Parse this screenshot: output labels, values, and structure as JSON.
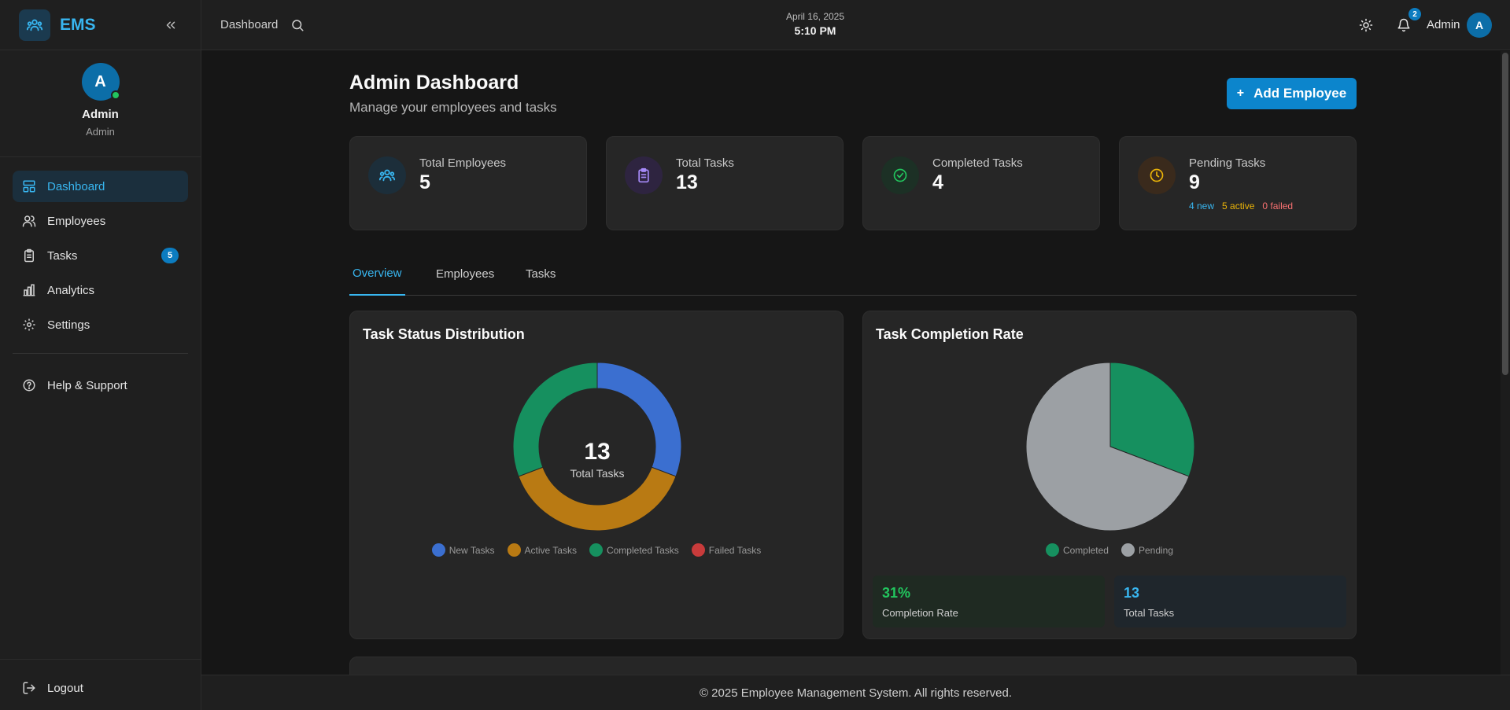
{
  "brand": {
    "name": "EMS",
    "logo_icon": "users-icon"
  },
  "profile": {
    "initial": "A",
    "name": "Admin",
    "role": "Admin"
  },
  "sidebar": {
    "items": [
      {
        "label": "Dashboard",
        "icon": "dashboard-icon",
        "active": true
      },
      {
        "label": "Employees",
        "icon": "users-icon"
      },
      {
        "label": "Tasks",
        "icon": "clipboard-icon",
        "badge": "5"
      },
      {
        "label": "Analytics",
        "icon": "bar-chart-icon"
      },
      {
        "label": "Settings",
        "icon": "gear-icon"
      }
    ],
    "help": {
      "label": "Help & Support",
      "icon": "help-circle-icon"
    },
    "logout": {
      "label": "Logout",
      "icon": "logout-icon"
    }
  },
  "header": {
    "breadcrumb": "Dashboard",
    "date": "April 16, 2025",
    "time": "5:10 PM",
    "notification_count": "2",
    "user_name": "Admin",
    "user_initial": "A"
  },
  "page": {
    "title": "Admin Dashboard",
    "subtitle": "Manage your employees and tasks",
    "add_button": "Add Employee"
  },
  "stats": [
    {
      "label": "Total Employees",
      "value": "5",
      "icon": "users-icon",
      "color": "#38b6f0"
    },
    {
      "label": "Total Tasks",
      "value": "13",
      "icon": "clipboard-icon",
      "color": "#a78bfa"
    },
    {
      "label": "Completed Tasks",
      "value": "4",
      "icon": "check-circle-icon",
      "color": "#22c55e"
    },
    {
      "label": "Pending Tasks",
      "value": "9",
      "icon": "clock-icon",
      "color": "#eab308",
      "breakdown": {
        "new": "4 new",
        "active": "5 active",
        "failed": "0 failed"
      }
    }
  ],
  "tabs": [
    {
      "label": "Overview",
      "active": true
    },
    {
      "label": "Employees"
    },
    {
      "label": "Tasks"
    }
  ],
  "status_card": {
    "title": "Task Status Distribution",
    "center_value": "13",
    "center_label": "Total Tasks"
  },
  "completion_card": {
    "title": "Task Completion Rate",
    "rate_value": "31%",
    "rate_label": "Completion Rate",
    "total_value": "13",
    "total_label": "Total Tasks"
  },
  "chart_data": [
    {
      "type": "pie",
      "variant": "donut",
      "title": "Task Status Distribution",
      "categories": [
        "New Tasks",
        "Active Tasks",
        "Completed Tasks",
        "Failed Tasks"
      ],
      "values": [
        4,
        5,
        4,
        0
      ],
      "colors": [
        "#3b6fd0",
        "#b97a13",
        "#16905f",
        "#c83b3b"
      ],
      "legend": "bottom"
    },
    {
      "type": "pie",
      "title": "Task Completion Rate",
      "categories": [
        "Completed",
        "Pending"
      ],
      "values": [
        4,
        9
      ],
      "colors": [
        "#16905f",
        "#9ca0a4"
      ],
      "legend": "bottom"
    }
  ],
  "footer": {
    "text": "© 2025 Employee Management System. All rights reserved."
  }
}
